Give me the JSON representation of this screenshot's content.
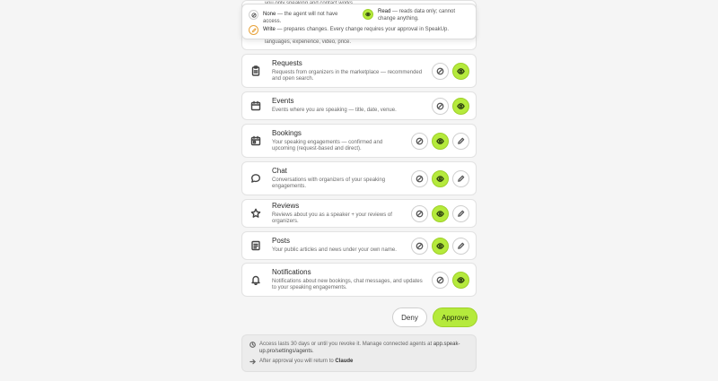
{
  "legend": {
    "none": {
      "label": "None",
      "text": " — the agent will not have access."
    },
    "read": {
      "label": "Read",
      "text": " — reads data only; cannot change anything."
    },
    "write": {
      "label": "Write",
      "text": " — prepares changes. Every change requires your approval in SpeakUp."
    }
  },
  "peek": {
    "line_top": "you only speaking and contact works",
    "line_bottom": "languages, experience, video, price."
  },
  "sections": [
    {
      "title": "Requests",
      "desc": "Requests from organizers in the marketplace — recommended and open search.",
      "icon": "clipboard-icon"
    },
    {
      "title": "Events",
      "desc": "Events where you are speaking — title, date, venue.",
      "icon": "calendar-icon"
    },
    {
      "title": "Bookings",
      "desc": "Your speaking engagements — confirmed and upcoming (request-based and direct).",
      "icon": "calendar-check-icon"
    },
    {
      "title": "Chat",
      "desc": "Conversations with organizers of your speaking engagements.",
      "icon": "chat-bubble-icon"
    },
    {
      "title": "Reviews",
      "desc": "Reviews about you as a speaker + your reviews of organizers.",
      "icon": "star-icon"
    },
    {
      "title": "Posts",
      "desc": "Your public articles and news under your own name.",
      "icon": "document-icon"
    },
    {
      "title": "Notifications",
      "desc": "Notifications about new bookings, chat messages, and updates to your speaking engagements.",
      "icon": "bell-icon"
    }
  ],
  "actions": {
    "deny": "Deny",
    "approve": "Approve"
  },
  "info": {
    "access_text": "Access lasts 30 days or until you revoke it. Manage connected agents at ",
    "access_link": "app.speak-up.pro/settings/agents",
    "access_end": ".",
    "return_text": "After approval you will return to ",
    "return_app": "Claude"
  },
  "colors": {
    "accent": "#b5ea3c",
    "write_accent": "#e8a23a"
  }
}
